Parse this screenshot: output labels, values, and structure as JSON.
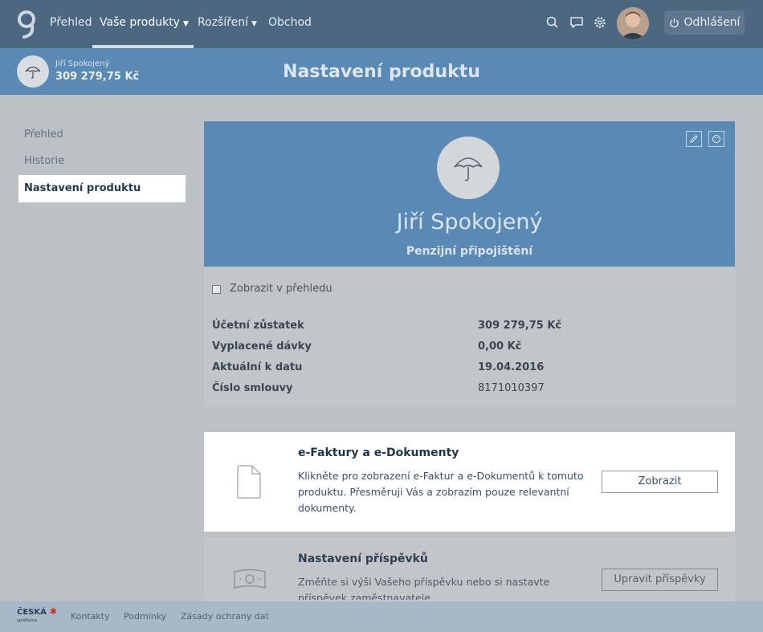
{
  "nav": {
    "items": [
      {
        "label": "Přehled"
      },
      {
        "label": "Vaše produkty"
      },
      {
        "label": "Rozšíření"
      },
      {
        "label": "Obchod"
      }
    ],
    "logout_label": "Odhlášení"
  },
  "subheader": {
    "name": "Jiří Spokojený",
    "amount": "309 279,75 Kč",
    "title": "Nastavení produktu"
  },
  "sidebar": {
    "items": [
      {
        "label": "Přehled"
      },
      {
        "label": "Historie"
      },
      {
        "label": "Nastavení produktu",
        "active": true
      }
    ]
  },
  "product": {
    "name": "Jiří Spokojený",
    "type": "Penzijní připojištění",
    "show_in_overview_label": "Zobrazit v přehledu",
    "show_in_overview_checked": false,
    "rows": [
      {
        "label": "Účetní zůstatek",
        "value": "309 279,75 Kč"
      },
      {
        "label": "Vyplacené dávky",
        "value": "0,00 Kč"
      },
      {
        "label": "Aktuální k datu",
        "value": "19.04.2016"
      },
      {
        "label": "Číslo smlouvy",
        "value": "8171010397"
      }
    ]
  },
  "einvoices": {
    "title": "e-Faktury a e-Dokumenty",
    "description": "Klikněte pro zobrazení e-Faktur a e-Dokumentů k tomuto produktu. Přesměruji Vás a zobrazím pouze relevantní dokumenty.",
    "button": "Zobrazit"
  },
  "contributions": {
    "title": "Nastavení příspěvků",
    "description": "Změňte si výši Vašeho příspěvku nebo si nastavte příspěvek zaměstnavatele.",
    "button": "Upravit příspěvky"
  },
  "footer": {
    "brand": "ČESKÁ",
    "brand_sub": "spořitelna",
    "links": [
      "Kontakty",
      "Podmínky",
      "Zásady ochrany dat"
    ]
  },
  "colors": {
    "topbar": "#4c6780",
    "subbar": "#5a89b4",
    "card_header": "#5b89b5",
    "brand_red": "#c9302c"
  },
  "icons": [
    "logo-icon",
    "search-icon",
    "chat-icon",
    "gear-icon",
    "power-icon",
    "umbrella-icon",
    "pencil-icon",
    "palette-icon",
    "document-icon",
    "banknote-icon",
    "chevron-down-icon"
  ]
}
